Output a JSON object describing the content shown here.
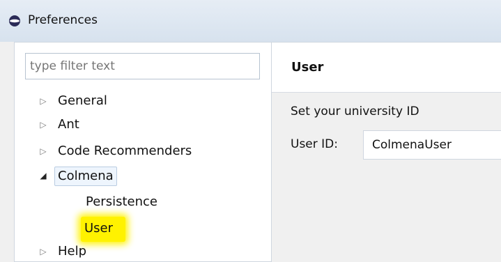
{
  "window": {
    "title": "Preferences"
  },
  "filter": {
    "placeholder": "type filter text",
    "value": ""
  },
  "tree": {
    "items": [
      {
        "label": "General",
        "expanded": false
      },
      {
        "label": "Ant",
        "expanded": false
      },
      {
        "label": "Code Recommenders",
        "expanded": false
      },
      {
        "label": "Colmena",
        "expanded": true
      },
      {
        "label": "Persistence",
        "parent": "Colmena"
      },
      {
        "label": "User",
        "parent": "Colmena",
        "highlighted": true,
        "selected": true
      },
      {
        "label": "Help",
        "expanded": false
      }
    ]
  },
  "page": {
    "title": "User",
    "instruction": "Set your university ID",
    "field_label": "User ID:",
    "field_value": "ColmenaUser"
  },
  "icons": {
    "app": "eclipse-preferences-icon",
    "collapsed": "triangle-right-icon",
    "expanded": "triangle-down-icon"
  },
  "colors": {
    "highlight": "#fff200",
    "selection_border": "#b9cce1",
    "pane_border": "#cfd6df"
  }
}
